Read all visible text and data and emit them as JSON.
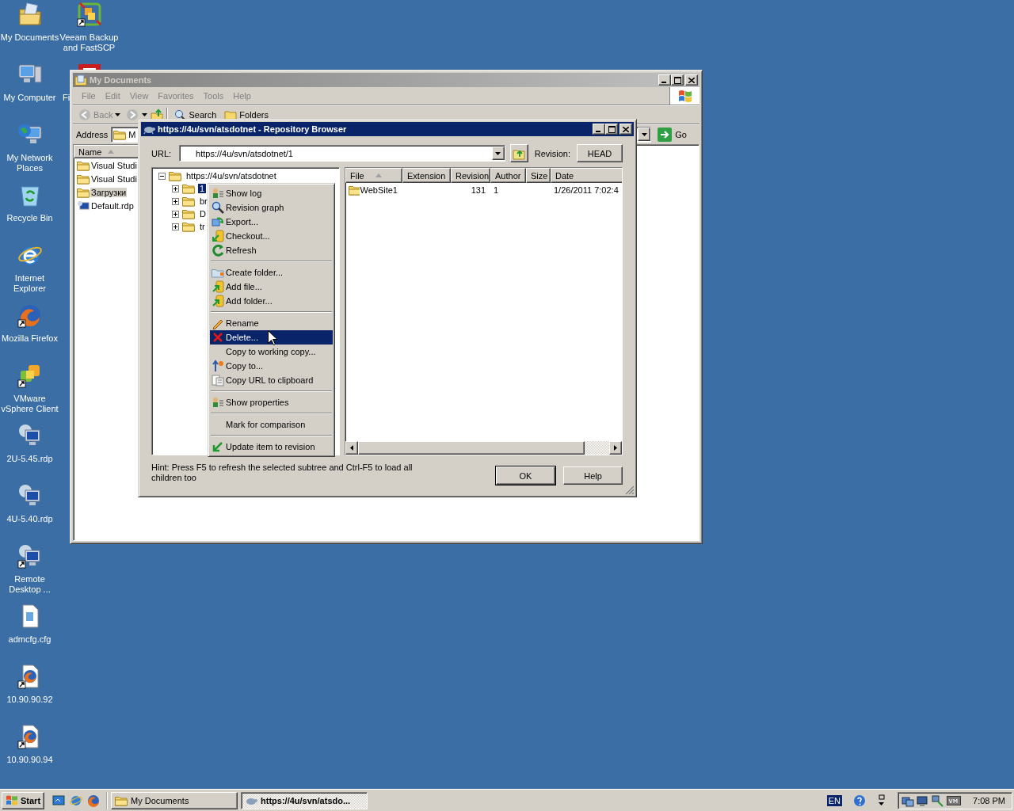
{
  "desktop": {
    "columns": [
      [
        {
          "label": "My Documents"
        },
        {
          "label": "My Computer"
        },
        {
          "label": "My Network Places"
        },
        {
          "label": "Recycle Bin"
        },
        {
          "label": "Internet Explorer"
        },
        {
          "label": "Mozilla Firefox"
        },
        {
          "label": "VMware vSphere Client"
        },
        {
          "label": "2U-5.45.rdp"
        },
        {
          "label": "4U-5.40.rdp"
        },
        {
          "label": "Remote Desktop ..."
        },
        {
          "label": "admcfg.cfg"
        },
        {
          "label": "10.90.90.92"
        },
        {
          "label": "10.90.90.94"
        }
      ],
      [
        {
          "label": "Veeam Backup and FastSCP"
        },
        {
          "label": "Fi"
        }
      ]
    ]
  },
  "explorer": {
    "title": "My Documents",
    "menu": [
      "File",
      "Edit",
      "View",
      "Favorites",
      "Tools",
      "Help"
    ],
    "toolbar": [
      {
        "label": "Back",
        "disabled": true
      },
      {
        "label": "Search",
        "disabled": false
      },
      {
        "label": "Folders",
        "disabled": false
      }
    ],
    "address": {
      "label": "Address",
      "value": "M"
    },
    "go": "Go",
    "list": {
      "column": "Name",
      "items": [
        {
          "label": "Visual Studi",
          "selected": false
        },
        {
          "label": "Visual Studi",
          "selected": false
        },
        {
          "label": "Загрузки",
          "selected": true
        },
        {
          "label": "Default.rdp",
          "selected": false
        }
      ]
    }
  },
  "dialog": {
    "title": "https://4u/svn/atsdotnet - Repository Browser",
    "url_label": "URL:",
    "url": "https://4u/svn/atsdotnet/1",
    "revision_label": "Revision:",
    "revision": "HEAD",
    "tree": {
      "label": "https://4u/svn/atsdotnet",
      "expanded": true,
      "selected": false,
      "children": [
        {
          "label": "1",
          "expanded": false,
          "selected": true
        },
        {
          "label": "br",
          "expanded": false,
          "selected": false
        },
        {
          "label": "D",
          "expanded": false,
          "selected": false
        },
        {
          "label": "tr",
          "expanded": false,
          "selected": false
        }
      ]
    },
    "list": {
      "columns": [
        "File",
        "Extension",
        "Revision",
        "Author",
        "Size",
        "Date"
      ],
      "rows": [
        [
          "WebSite1",
          "",
          "131",
          "1",
          "",
          "1/26/2011 7:02:4"
        ]
      ]
    },
    "hint": "Hint: Press F5 to refresh the selected subtree and Ctrl-F5 to load all children too",
    "buttons": [
      "OK",
      "Help"
    ]
  },
  "context_menu": {
    "groups": [
      [
        {
          "label": "Show log",
          "selected": false
        },
        {
          "label": "Revision graph",
          "selected": false
        },
        {
          "label": "Export...",
          "selected": false
        },
        {
          "label": "Checkout...",
          "selected": false
        },
        {
          "label": "Refresh",
          "selected": false
        }
      ],
      [
        {
          "label": "Create folder...",
          "selected": false
        },
        {
          "label": "Add file...",
          "selected": false
        },
        {
          "label": "Add folder...",
          "selected": false
        }
      ],
      [
        {
          "label": "Rename",
          "selected": false
        },
        {
          "label": "Delete...",
          "selected": true
        },
        {
          "label": "Copy to working copy...",
          "selected": false
        },
        {
          "label": "Copy to...",
          "selected": false
        },
        {
          "label": "Copy URL to clipboard",
          "selected": false
        }
      ],
      [
        {
          "label": "Show properties",
          "selected": false
        }
      ],
      [
        {
          "label": "Mark for comparison",
          "selected": false
        }
      ],
      [
        {
          "label": "Update item to revision",
          "selected": false
        }
      ]
    ]
  },
  "taskbar": {
    "start": "Start",
    "tasks": [
      {
        "label": "My Documents",
        "selected": false
      },
      {
        "label": "https://4u/svn/atsdo...",
        "selected": true
      }
    ],
    "language": "EN",
    "clock": "7:08 PM"
  }
}
